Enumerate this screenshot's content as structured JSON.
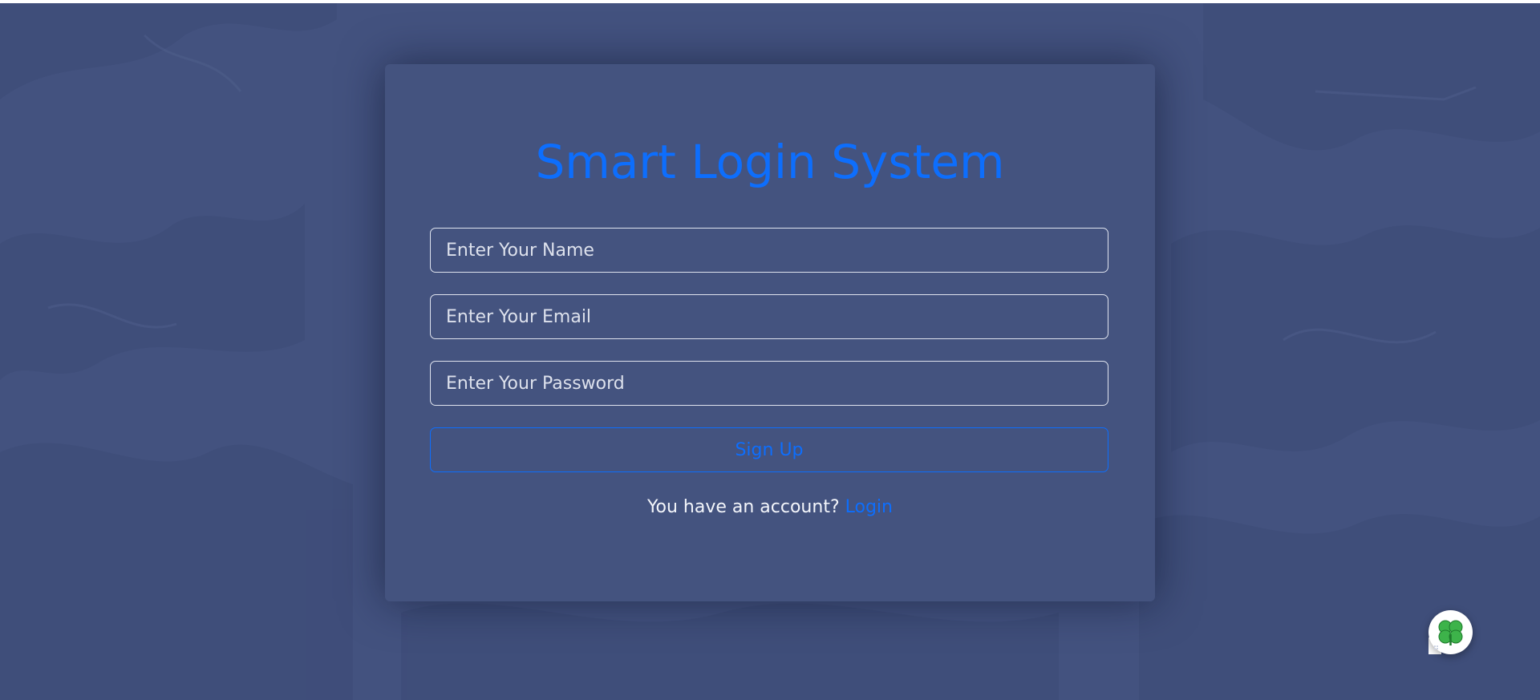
{
  "app": {
    "title": "Smart Login System"
  },
  "form": {
    "name_placeholder": "Enter Your Name",
    "name_value": "",
    "email_placeholder": "Enter Your Email",
    "email_value": "",
    "password_placeholder": "Enter Your Password",
    "password_value": "",
    "signup_label": "Sign Up"
  },
  "footer": {
    "prompt": "You have an account? ",
    "login_label": "Login"
  },
  "widget": {
    "icon": "clover-icon"
  },
  "colors": {
    "background": "#43527f",
    "card": "#44537f",
    "accent": "#0d6efd",
    "text": "#f4f6fb"
  }
}
